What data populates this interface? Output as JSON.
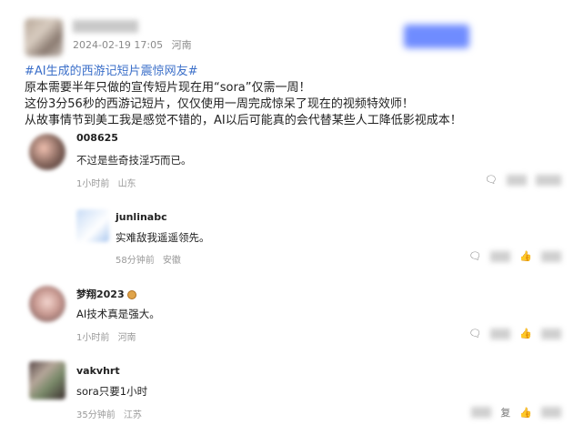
{
  "post": {
    "timestamp": "2024-02-19 17:05",
    "location": "河南",
    "topic": "#AI生成的西游记短片震惊网友#",
    "lines": [
      "原本需要半年只做的宣传短片现在用“sora”仅需一周！",
      "这份3分56秒的西游记短片，仅仅使用一周完成惊呆了现在的视频特效师！",
      "从故事情节到美工我是感觉不错的，AI以后可能真的会代替某些人工降低影视成本！"
    ]
  },
  "comments": [
    {
      "name": "008625",
      "text": "不过是些奇技淫巧而已。",
      "time": "1小时前",
      "location": "山东"
    },
    {
      "name": "junlinabc",
      "text": "实难敌我遥遥领先。",
      "time": "58分钟前",
      "location": "安徽"
    },
    {
      "name": "梦翔2023",
      "text": "AI技术真是强大。",
      "time": "1小时前",
      "location": "河南"
    },
    {
      "name": "vakvhrt",
      "text": "sora只要1小时",
      "time": "35分钟前",
      "location": "江苏",
      "reply_label": "复"
    }
  ],
  "icons": {
    "comment": "comment-icon",
    "like": "thumbs-up-icon"
  }
}
